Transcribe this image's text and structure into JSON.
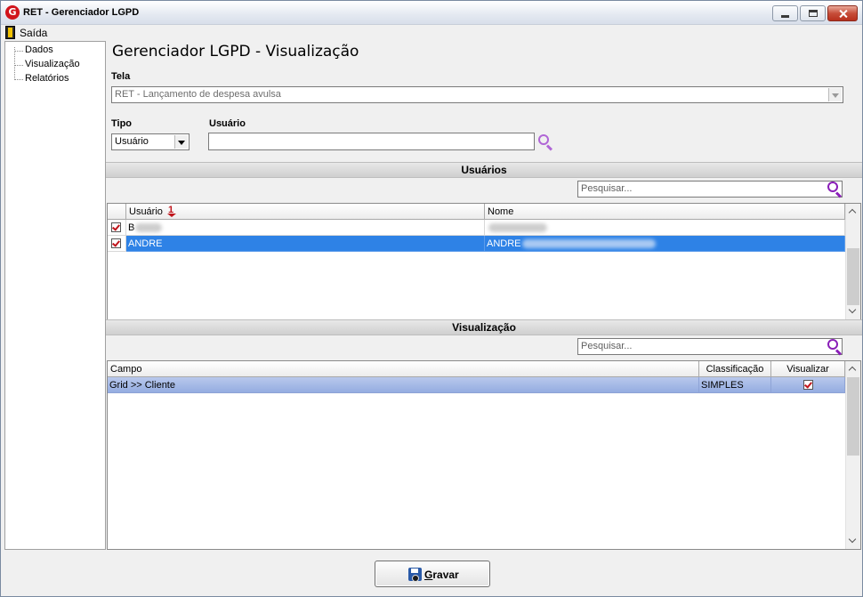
{
  "window": {
    "title": "RET - Gerenciador LGPD",
    "icon": "app-logo-icon",
    "controls": [
      "minimize-icon",
      "maximize-icon",
      "close-icon"
    ]
  },
  "menu": {
    "exit_label": "Saída",
    "exit_icon": "door-exit-icon"
  },
  "tree": {
    "items": [
      {
        "label": "Dados"
      },
      {
        "label": "Visualização"
      },
      {
        "label": "Relatórios"
      }
    ]
  },
  "page": {
    "title": "Gerenciador LGPD - Visualização"
  },
  "form": {
    "tela_label": "Tela",
    "tela_value": "RET - Lançamento de despesa avulsa",
    "tipo_label": "Tipo",
    "tipo_value": "Usuário",
    "usuario_label": "Usuário",
    "usuario_value": ""
  },
  "users_section": {
    "header": "Usuários",
    "search_placeholder": "Pesquisar...",
    "columns": [
      "Usuário",
      "Nome"
    ],
    "sort_indicator": "1",
    "rows": [
      {
        "checked": true,
        "usuario": "B",
        "nome": "",
        "selected": false
      },
      {
        "checked": true,
        "usuario": "ANDRE",
        "nome": "ANDRE",
        "selected": true
      }
    ]
  },
  "view_section": {
    "header": "Visualização",
    "search_placeholder": "Pesquisar...",
    "columns": [
      "Campo",
      "Classificação",
      "Visualizar"
    ],
    "rows": [
      {
        "campo": "Grid >> Cliente",
        "classificacao": "SIMPLES",
        "visualizar": true
      }
    ]
  },
  "footer": {
    "save_label_underlined": "G",
    "save_label_rest": "ravar",
    "save_icon": "floppy-disk-icon"
  },
  "colors": {
    "selection": "#2e82e6",
    "highlight_row": "#a6b9e6",
    "search_icon": "#8a1fb8",
    "accent_red": "#c0141b"
  }
}
